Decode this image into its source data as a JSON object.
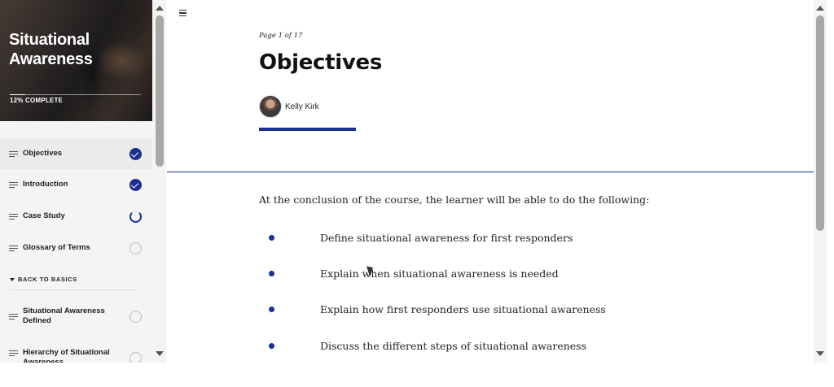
{
  "course": {
    "title_line1": "Situational",
    "title_line2": "Awareness",
    "progress_text": "12% COMPLETE",
    "progress_fraction": 0.12
  },
  "sidebar": {
    "lessons": [
      {
        "label": "Objectives",
        "status": "complete"
      },
      {
        "label": "Introduction",
        "status": "complete"
      },
      {
        "label": "Case Study",
        "status": "in-progress"
      },
      {
        "label": "Glossary of Terms",
        "status": "not-started"
      }
    ],
    "section": {
      "label": "BACK TO BASICS",
      "lessons": [
        {
          "label": "Situational Awareness Defined",
          "status": "not-started"
        },
        {
          "label": "Hierarchy of Situational Awareness",
          "status": "not-started"
        }
      ]
    }
  },
  "main": {
    "page_indicator": "Page 1 of 17",
    "heading": "Objectives",
    "author": "Kelly Kirk",
    "intro": "At the conclusion of the course, the learner will be able to do the following:",
    "objectives": [
      "Define situational awareness for first responders",
      "Explain when situational awareness is needed",
      "Explain how first responders use situational awareness",
      "Discuss the different steps of situational awareness"
    ]
  },
  "colors": {
    "accent": "#1a2f8f",
    "sidebar_bg": "#f4f4f4"
  },
  "icons": {
    "menu": "hamburger-menu-icon",
    "lesson": "lines-icon",
    "complete": "checkmark-circle-icon",
    "in_progress": "progress-ring-icon",
    "not_started": "empty-circle-icon",
    "section_toggle": "caret-down-icon"
  }
}
